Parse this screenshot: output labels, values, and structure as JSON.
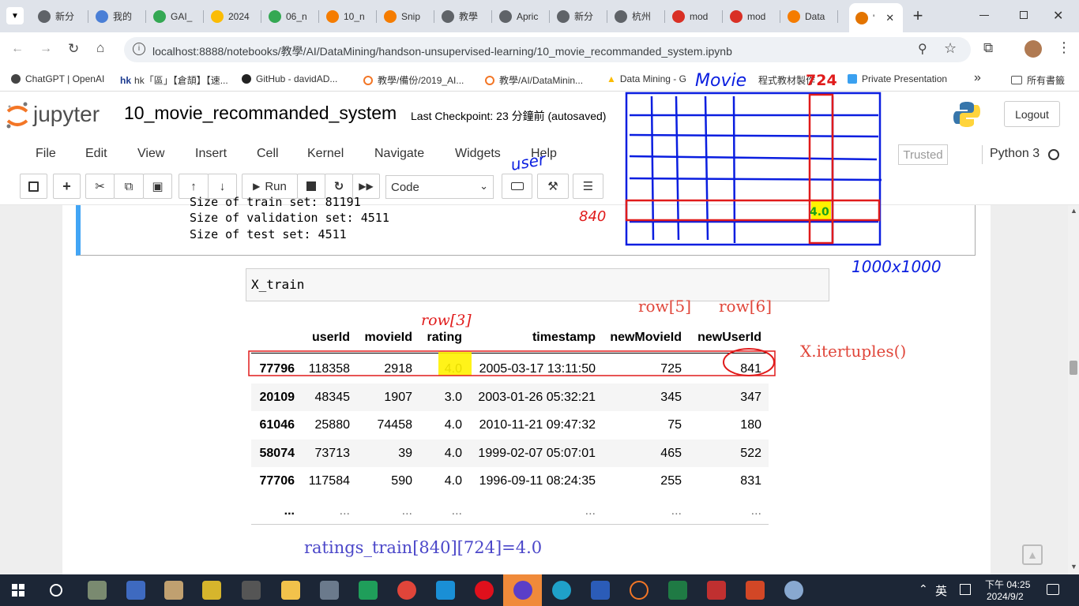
{
  "browser": {
    "tabs": [
      {
        "label": "新分",
        "color": "#5f6368"
      },
      {
        "label": "我的",
        "color": "#4a7fd6"
      },
      {
        "label": "GAI_",
        "color": "#34a853"
      },
      {
        "label": "2024",
        "color": "#fbbc04"
      },
      {
        "label": "06_n",
        "color": "#34a853"
      },
      {
        "label": "10_n",
        "color": "#f57c00"
      },
      {
        "label": "Snip",
        "color": "#f57c00"
      },
      {
        "label": "教學",
        "color": "#5f6368"
      },
      {
        "label": "Apric",
        "color": "#5f6368"
      },
      {
        "label": "新分",
        "color": "#5f6368"
      },
      {
        "label": "杭州",
        "color": "#5f6368"
      },
      {
        "label": "mod",
        "color": "#d93025"
      },
      {
        "label": "mod",
        "color": "#d93025"
      },
      {
        "label": "Data",
        "color": "#f57c00"
      },
      {
        "label": "'",
        "color": "#e37400"
      }
    ],
    "close_glyph": "✕",
    "new_tab_glyph": "+",
    "url": "localhost:8888/notebooks/教學/AI/DataMining/handson-unsupervised-learning/10_movie_recommanded_system.ipynb",
    "bookmarks": [
      "ChatGPT | OpenAI",
      "hk「區」【倉頡】【速...",
      "GitHub - davidAD...",
      "教學/備份/2019_AI...",
      "教學/AI/DataMinin...",
      "Data Mining - G",
      "程式教材製作",
      "Private Presentation"
    ],
    "bookmarks_more": "»",
    "all_bookmarks": "所有書籤"
  },
  "jupyter": {
    "logo_text": "jupyter",
    "notebook_name": "10_movie_recommanded_system",
    "checkpoint": "Last Checkpoint: 23 分鐘前   (autosaved)",
    "logout": "Logout",
    "menu": [
      "File",
      "Edit",
      "View",
      "Insert",
      "Cell",
      "Kernel",
      "Navigate",
      "Widgets",
      "Help"
    ],
    "trusted": "Trusted",
    "kernel": "Python 3",
    "run_label": "Run",
    "cell_type": "Code"
  },
  "output_lines": [
    "Size of train set: 81191",
    "Size of validation set: 4511",
    "Size of test set: 4511"
  ],
  "input_code": "X_train",
  "dataframe": {
    "columns": [
      "userId",
      "movieId",
      "rating",
      "timestamp",
      "newMovieId",
      "newUserId"
    ],
    "rows": [
      {
        "index": "77796",
        "cells": [
          "118358",
          "2918",
          "4.0",
          "2005-03-17 13:11:50",
          "725",
          "841"
        ]
      },
      {
        "index": "20109",
        "cells": [
          "48345",
          "1907",
          "3.0",
          "2003-01-26 05:32:21",
          "345",
          "347"
        ]
      },
      {
        "index": "61046",
        "cells": [
          "25880",
          "74458",
          "4.0",
          "2010-11-21 09:47:32",
          "75",
          "180"
        ]
      },
      {
        "index": "58074",
        "cells": [
          "73713",
          "39",
          "4.0",
          "1999-02-07 05:07:01",
          "465",
          "522"
        ]
      },
      {
        "index": "77706",
        "cells": [
          "117584",
          "590",
          "4.0",
          "1996-09-11 08:24:35",
          "255",
          "831"
        ]
      }
    ],
    "ellipsis": "..."
  },
  "annotations": {
    "movie": "Movie",
    "col_num": "724",
    "user": "user",
    "row_num": "840",
    "grid_value": "4.0",
    "size": "1000x1000",
    "row3": "row[3]",
    "row5": "row[5]",
    "row6": "row[6]",
    "itertuples": "X.itertuples()",
    "formula": "ratings_train[840][724]=4.0",
    "highlight_color": "#fff200",
    "ink_blue": "#0a1ee0",
    "ink_red": "#e01b1b"
  },
  "taskbar": {
    "ime": "英",
    "time": "下午 04:25",
    "date": "2024/9/2"
  }
}
